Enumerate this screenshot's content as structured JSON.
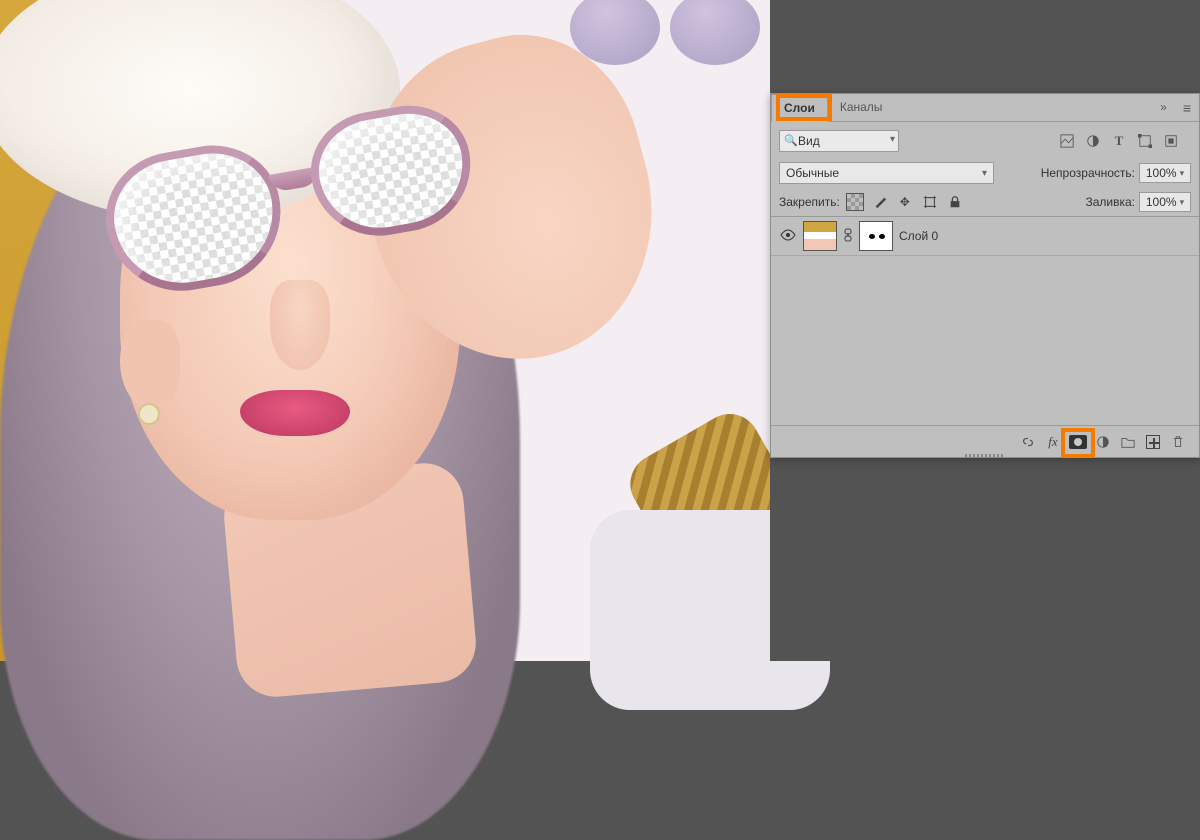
{
  "panel": {
    "tabs": {
      "layers": "Слои",
      "channels": "Каналы"
    },
    "search_placeholder": "Вид",
    "blend_mode": "Обычные",
    "opacity_label": "Непрозрачность:",
    "opacity_value": "100%",
    "lock_label": "Закрепить:",
    "fill_label": "Заливка:",
    "fill_value": "100%",
    "filter_icons": {
      "pixel": "image-filter-icon",
      "adjust": "adjustment-filter-icon",
      "type": "type-filter-icon",
      "shape": "shape-filter-icon",
      "smart": "smart-filter-icon"
    }
  },
  "layers": [
    {
      "name": "Слой 0",
      "visible": true,
      "has_mask": true
    }
  ],
  "footer": {
    "link": "link-layers-icon",
    "fx": "fx",
    "mask": "add-mask-icon",
    "adjust": "new-adjustment-icon",
    "group": "new-group-icon",
    "new": "new-layer-icon",
    "trash": "delete-layer-icon"
  },
  "highlights": {
    "tab": "layers-tab",
    "footer_button": "add-mask-button"
  }
}
